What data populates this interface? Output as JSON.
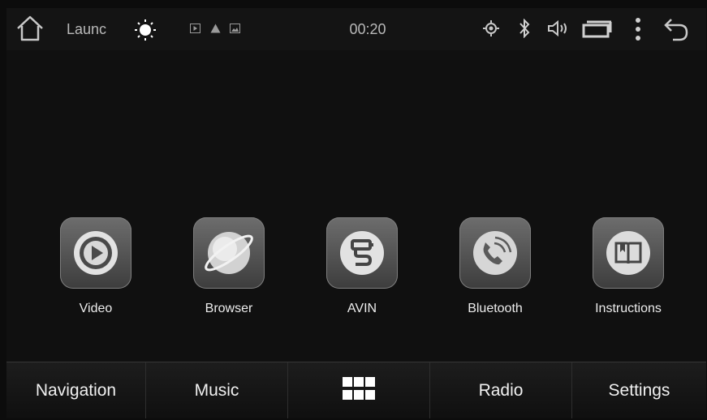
{
  "status_bar": {
    "home_icon": "home-icon",
    "app_title": "Launc",
    "brightness_icon": "sun-icon",
    "notification_icons": [
      "play-icon",
      "warning-icon",
      "image-icon"
    ],
    "time": "00:20",
    "system_icons": [
      "location-icon",
      "bluetooth-icon",
      "volume-icon",
      "recent-apps-icon",
      "more-icon",
      "back-icon"
    ]
  },
  "apps": [
    {
      "label": "Video",
      "icon": "video-icon"
    },
    {
      "label": "Browser",
      "icon": "browser-icon"
    },
    {
      "label": "AVIN",
      "icon": "avin-icon"
    },
    {
      "label": "Bluetooth",
      "icon": "bluetooth-phone-icon"
    },
    {
      "label": "Instructions",
      "icon": "instructions-icon"
    }
  ],
  "dock": {
    "items": [
      {
        "label": "Navigation"
      },
      {
        "label": "Music"
      },
      {
        "label": ""
      },
      {
        "label": "Radio"
      },
      {
        "label": "Settings"
      }
    ]
  }
}
